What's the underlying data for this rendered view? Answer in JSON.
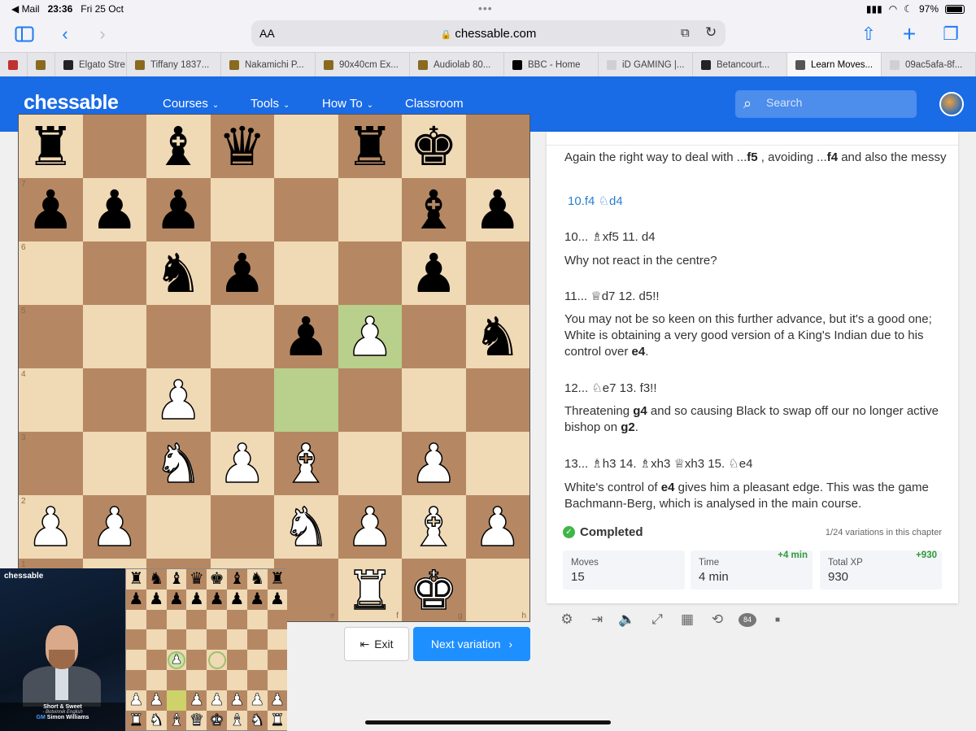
{
  "status": {
    "back_app": "◀ Mail",
    "time": "23:36",
    "date": "Fri 25 Oct",
    "battery": "97%"
  },
  "browser": {
    "aa": "AA",
    "url": "chessable.com"
  },
  "tabs": [
    {
      "label": "",
      "color": "#c03030"
    },
    {
      "label": "",
      "color": "#8a6a1e"
    },
    {
      "label": "Elgato Stre...",
      "color": "#222222"
    },
    {
      "label": "Tiffany 1837...",
      "color": "#8a6a1e"
    },
    {
      "label": "Nakamichi P...",
      "color": "#8a6a1e"
    },
    {
      "label": "90x40cm Ex...",
      "color": "#8a6a1e"
    },
    {
      "label": "Audiolab 80...",
      "color": "#8a6a1e"
    },
    {
      "label": "BBC - Home",
      "color": "#000000"
    },
    {
      "label": "iD GAMING |...",
      "color": "#cfcfd4"
    },
    {
      "label": "Betancourt...",
      "color": "#222222"
    },
    {
      "label": "Learn Moves...",
      "color": "#555555"
    },
    {
      "label": "09ac5afa-8f...",
      "color": "#cfcfd4"
    }
  ],
  "header": {
    "logo": "chessable",
    "nav": [
      "Courses",
      "Tools",
      "How To",
      "Classroom"
    ],
    "search_placeholder": "Search"
  },
  "board": {
    "ranks": [
      [
        "r",
        "",
        "b",
        "q",
        "",
        "r",
        "k",
        ""
      ],
      [
        "p",
        "p",
        "p",
        "",
        "",
        "",
        "b",
        "p"
      ],
      [
        "",
        "",
        "n",
        "p",
        "",
        "",
        "p",
        ""
      ],
      [
        "",
        "",
        "",
        "",
        "p",
        "P",
        "",
        "n"
      ],
      [
        "",
        "",
        "P",
        "",
        "",
        "",
        "",
        ""
      ],
      [
        "",
        "",
        "N",
        "P",
        "B",
        "",
        "P",
        ""
      ],
      [
        "P",
        "P",
        "",
        "",
        "N",
        "P",
        "B",
        "P"
      ],
      [
        "",
        "",
        "",
        "",
        "",
        "R",
        "K",
        ""
      ]
    ],
    "highlights": [
      [
        3,
        5
      ],
      [
        4,
        4
      ]
    ],
    "rank_labels": [
      "",
      "7",
      "6",
      "5",
      "4",
      "3",
      "2",
      "1"
    ],
    "file_labels": [
      "",
      "",
      "",
      "",
      "e",
      "f",
      "g",
      "h"
    ]
  },
  "buttons": {
    "exit": "Exit",
    "next": "Next variation"
  },
  "panel": {
    "p1": [
      "Again the right way to deal with ...",
      "f5",
      " , avoiding ...",
      "f4",
      " and also the messy"
    ],
    "link_move": "10.f4 ♘d4",
    "m1": "10... ♗xf5  11. d4",
    "t1": "Why not react in the centre?",
    "m2": "11... ♕d7  12. d5!!",
    "t2": [
      "You may not be so keen on this further advance, but it's a good one; White is obtaining a very good version of a King's Indian due to his control over ",
      "e4",
      "."
    ],
    "m3": "12... ♘e7  13. f3!!",
    "t3": [
      "Threatening ",
      "g4",
      " and so causing Black to swap off our no longer active bishop on ",
      "g2",
      "."
    ],
    "m4": "13... ♗h3  14. ♗xh3  ♕xh3  15. ♘e4",
    "t4": [
      "White's control of ",
      "e4",
      " gives him a pleasant edge. This was the game Bachmann-Berg, which is analysed in the main course."
    ],
    "completed": "Completed",
    "variations": "1/24 variations in this chapter",
    "stats": [
      {
        "label": "Moves",
        "value": "15",
        "delta": ""
      },
      {
        "label": "Time",
        "value": "4 min",
        "delta": "+4 min"
      },
      {
        "label": "Total XP",
        "value": "930",
        "delta": "+930"
      }
    ],
    "comment_count": "84"
  },
  "video": {
    "logo": "chessable",
    "title": "Short & Sweet",
    "subtitle": "- Botvinnik English",
    "gm": "GM",
    "author": "Simon Williams"
  },
  "mini_board": {
    "ranks": [
      [
        "r",
        "n",
        "b",
        "q",
        "k",
        "b",
        "n",
        "r"
      ],
      [
        "p",
        "p",
        "p",
        "p",
        "p",
        "p",
        "p",
        "p"
      ],
      [
        "",
        "",
        "",
        "",
        "",
        "",
        "",
        ""
      ],
      [
        "",
        "",
        "",
        "",
        "",
        "",
        "",
        ""
      ],
      [
        "",
        "",
        "(P)",
        "",
        "o",
        "",
        "",
        ""
      ],
      [
        "",
        "",
        "",
        "",
        "",
        "",
        "",
        ""
      ],
      [
        "P",
        "P",
        "*",
        "P",
        "P",
        "P",
        "P",
        "P"
      ],
      [
        "R",
        "N",
        "B",
        "Q",
        "K",
        "B",
        "N",
        "R"
      ]
    ]
  }
}
